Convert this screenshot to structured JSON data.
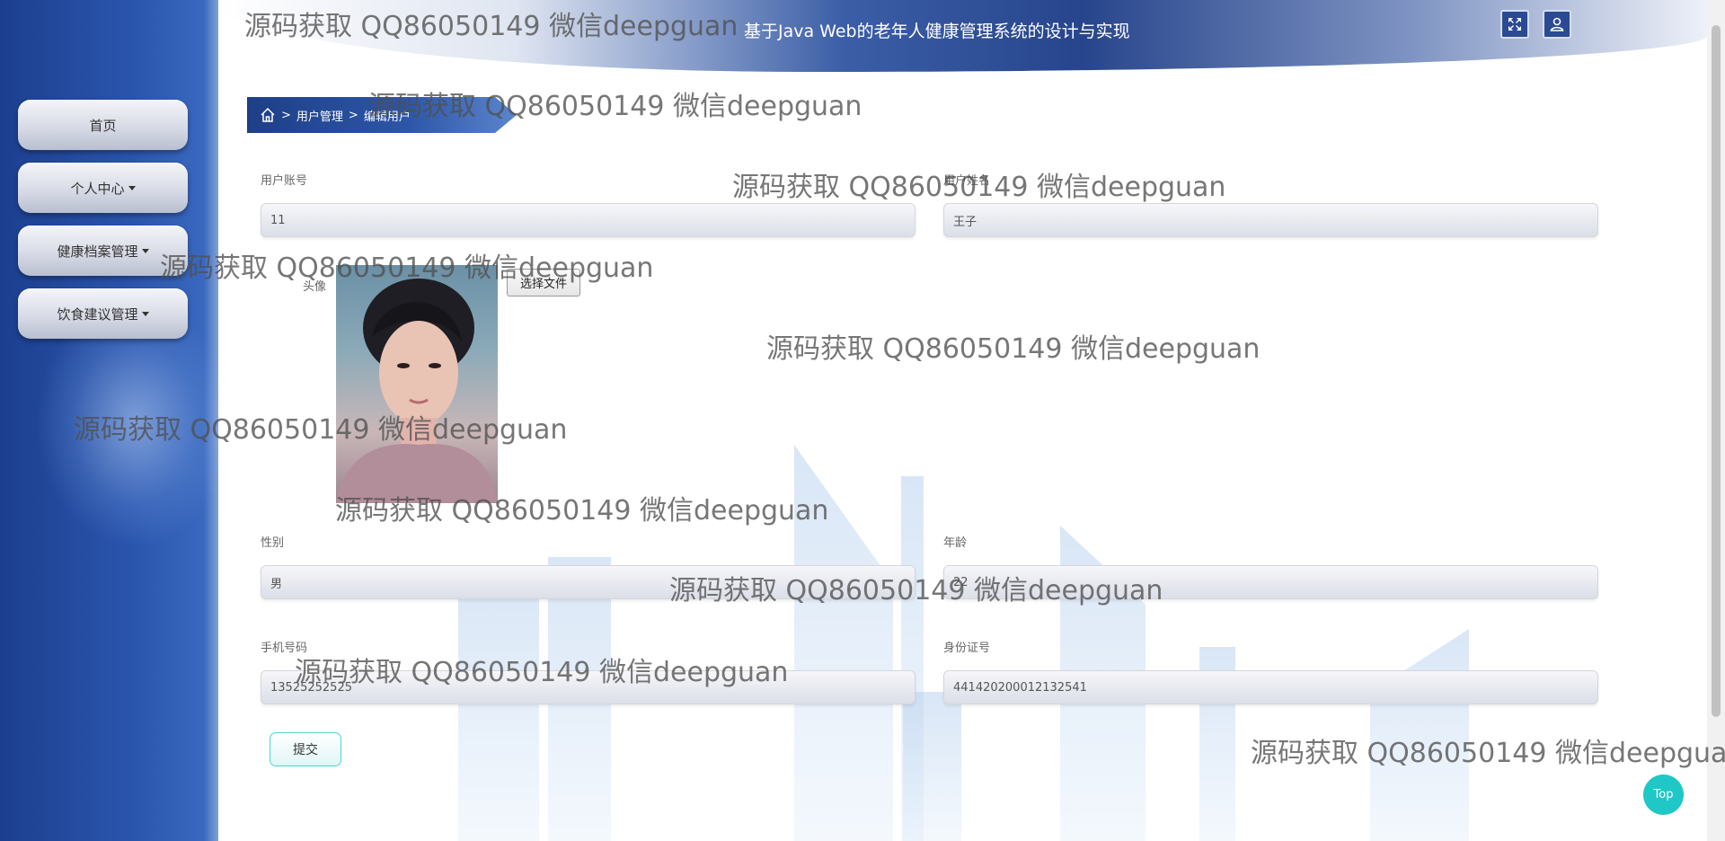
{
  "header": {
    "title": "基于Java Web的老年人健康管理系统的设计与实现",
    "fullscreen_icon": "fullscreen-icon",
    "user_icon": "user-icon"
  },
  "sidebar": {
    "items": [
      {
        "label": "首页",
        "has_dropdown": false
      },
      {
        "label": "个人中心",
        "has_dropdown": true
      },
      {
        "label": "健康档案管理",
        "has_dropdown": true
      },
      {
        "label": "饮食建议管理",
        "has_dropdown": true
      }
    ]
  },
  "breadcrumb": {
    "home_icon": "home-icon",
    "separator": ">",
    "items": [
      "用户管理",
      "编辑用户"
    ]
  },
  "form": {
    "account": {
      "label": "用户账号",
      "value": "11"
    },
    "name": {
      "label": "用户姓名",
      "value": "王子"
    },
    "avatar": {
      "label": "头像",
      "choose_file": "选择文件"
    },
    "gender": {
      "label": "性别",
      "value": "男"
    },
    "age": {
      "label": "年龄",
      "value": "22"
    },
    "phone": {
      "label": "手机号码",
      "value": "13525252525"
    },
    "id_card": {
      "label": "身份证号",
      "value": "441420200012132541"
    },
    "submit": "提交"
  },
  "top_button": "Top",
  "watermark": "源码获取 QQ86050149 微信deepguan",
  "colors": {
    "sidebar": "#2a55ad",
    "header_dark": "#27458c",
    "accent_teal": "#1fc7c6"
  }
}
